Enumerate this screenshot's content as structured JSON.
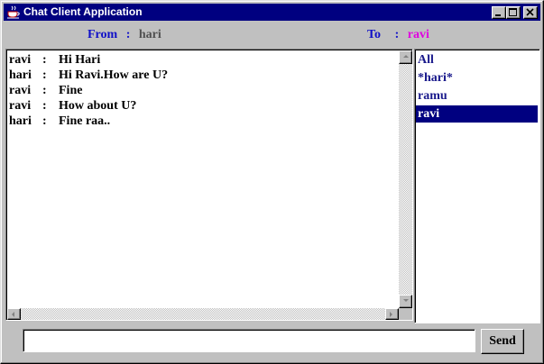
{
  "window": {
    "title": "Chat Client Application",
    "icon": "java-cup-icon",
    "controls": [
      "minimize-icon",
      "maximize-icon",
      "close-icon"
    ]
  },
  "header": {
    "from_label": "From",
    "from_separator": ":",
    "from_value": "hari",
    "to_label": "To",
    "to_separator": ":",
    "to_value": "ravi"
  },
  "messages": [
    {
      "sender": "ravi",
      "sep": ":",
      "text": "Hi Hari"
    },
    {
      "sender": "hari",
      "sep": ":",
      "text": "Hi Ravi.How are U?"
    },
    {
      "sender": "ravi",
      "sep": ":",
      "text": "Fine"
    },
    {
      "sender": "ravi",
      "sep": ":",
      "text": "How about U?"
    },
    {
      "sender": "hari",
      "sep": ":",
      "text": "Fine raa.."
    }
  ],
  "users": {
    "items": [
      "All",
      "*hari*",
      "ramu",
      "ravi"
    ],
    "selected": "ravi"
  },
  "input": {
    "value": "",
    "placeholder": ""
  },
  "send_button": {
    "label": "Send"
  },
  "colors": {
    "titlebar": "#000080",
    "label_blue": "#1010c8",
    "to_value": "#e000e0",
    "from_value": "#505050",
    "selection": "#000080"
  }
}
